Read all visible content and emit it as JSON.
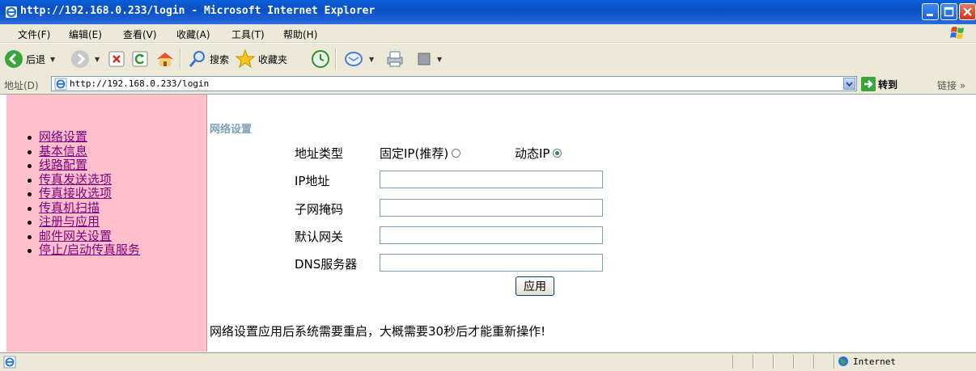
{
  "window": {
    "title": "http://192.168.0.233/login - Microsoft Internet Explorer"
  },
  "menu": [
    "文件(F)",
    "编辑(E)",
    "查看(V)",
    "收藏(A)",
    "工具(T)",
    "帮助(H)"
  ],
  "toolbar": {
    "back_label": "后退",
    "search_label": "搜索",
    "favorites_label": "收藏夹"
  },
  "address_bar": {
    "label": "地址(D)",
    "url": "http://192.168.0.233/login",
    "go_label": "转到",
    "links_label": "链接 »"
  },
  "sidebar": {
    "links": [
      "网络设置",
      "基本信息",
      "线路配置",
      "传真发送选项",
      "传真接收选项",
      "传真机扫描",
      "注册与应用",
      "邮件网关设置",
      "停止/启动传真服务"
    ]
  },
  "main": {
    "heading": "网络设置",
    "address_type_label": "地址类型",
    "static_ip_label": "固定IP(推荐)",
    "dynamic_ip_label": "动态IP",
    "selected_address_type": "dynamic",
    "ip_label": "IP地址",
    "ip_value": "",
    "mask_label": "子网掩码",
    "mask_value": "",
    "gateway_label": "默认网关",
    "gateway_value": "",
    "dns_label": "DNS服务器",
    "dns_value": "",
    "apply_label": "应用",
    "note": "网络设置应用后系统需要重启，大概需要30秒后才能重新操作!"
  },
  "status_bar": {
    "zone_label": "Internet"
  },
  "colors": {
    "sidebar_bg": "#ffc0cb",
    "link": "#800080",
    "heading": "#7fa1b6",
    "titlebar": "#0b4fc4"
  }
}
